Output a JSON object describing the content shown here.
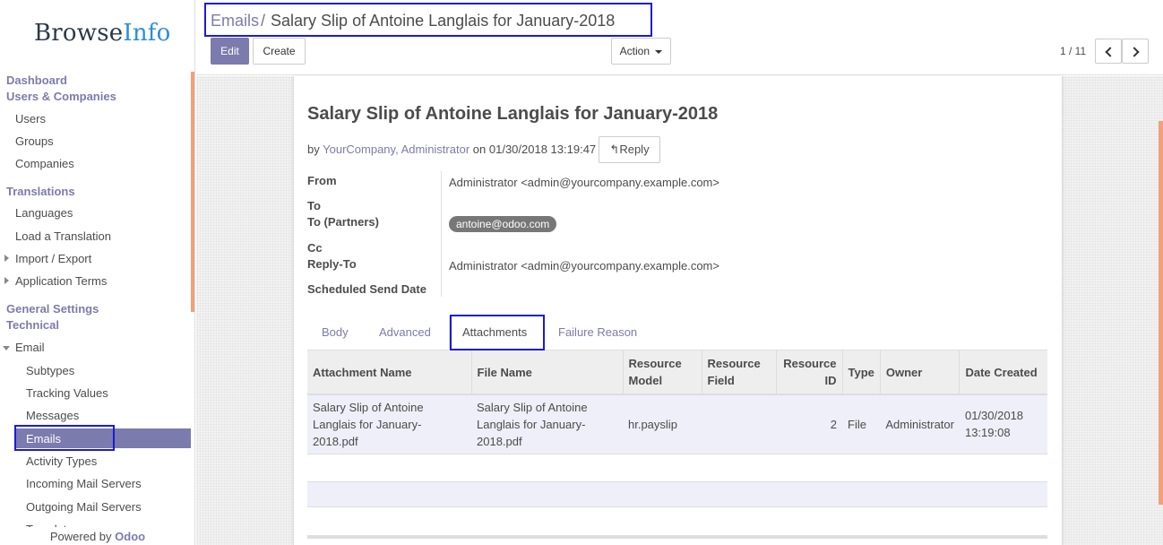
{
  "brand": {
    "name_prefix": "Browse",
    "name_suffix": "Info"
  },
  "sidebar": {
    "dashboard": "Dashboard",
    "users_companies": "Users & Companies",
    "users": "Users",
    "groups": "Groups",
    "companies": "Companies",
    "translations": "Translations",
    "languages": "Languages",
    "load_translation": "Load a Translation",
    "import_export": "Import / Export",
    "application_terms": "Application Terms",
    "general_settings": "General Settings",
    "technical": "Technical",
    "email": "Email",
    "subtypes": "Subtypes",
    "tracking_values": "Tracking Values",
    "messages": "Messages",
    "emails": "Emails",
    "activity_types": "Activity Types",
    "incoming_mail_servers": "Incoming Mail Servers",
    "outgoing_mail_servers": "Outgoing Mail Servers",
    "templates": "Templates",
    "powered_by": "Powered by",
    "powered_brand": "Odoo"
  },
  "breadcrumb": {
    "parent": "Emails",
    "separator": "/",
    "current": "Salary Slip of Antoine Langlais for January-2018"
  },
  "toolbar": {
    "edit_label": "Edit",
    "create_label": "Create",
    "action_label": "Action"
  },
  "pager": {
    "value": "1 / 11"
  },
  "record": {
    "title": "Salary Slip of Antoine Langlais for January-2018",
    "by_label": "by",
    "author": "YourCompany, Administrator",
    "on_label": "on",
    "date": "01/30/2018 13:19:47",
    "reply_label": "Reply"
  },
  "fields": {
    "from_label": "From",
    "from_value": "Administrator <admin@yourcompany.example.com>",
    "to_label": "To",
    "to_partners_label": "To (Partners)",
    "to_partners_tag": "antoine@odoo.com",
    "cc_label": "Cc",
    "reply_to_label": "Reply-To",
    "reply_to_value": "Administrator <admin@yourcompany.example.com>",
    "scheduled_label": "Scheduled Send Date"
  },
  "tabs": {
    "body": "Body",
    "advanced": "Advanced",
    "attachments": "Attachments",
    "failure": "Failure Reason"
  },
  "attachments": {
    "headers": {
      "name": "Attachment Name",
      "file": "File Name",
      "res_model": "Resource Model",
      "res_field": "Resource Field",
      "res_id": "Resource ID",
      "type": "Type",
      "owner": "Owner",
      "date": "Date Created"
    },
    "rows": [
      {
        "name": "Salary Slip of Antoine Langlais for January-2018.pdf",
        "file": "Salary Slip of Antoine Langlais for January-2018.pdf",
        "res_model": "hr.payslip",
        "res_field": "",
        "res_id": "2",
        "type": "File",
        "owner": "Administrator",
        "date": "01/30/2018 13:19:08"
      }
    ]
  },
  "colors": {
    "accent": "#7c7bad",
    "highlight": "#1a1adc",
    "scroll_accent": "#f0a07a"
  }
}
